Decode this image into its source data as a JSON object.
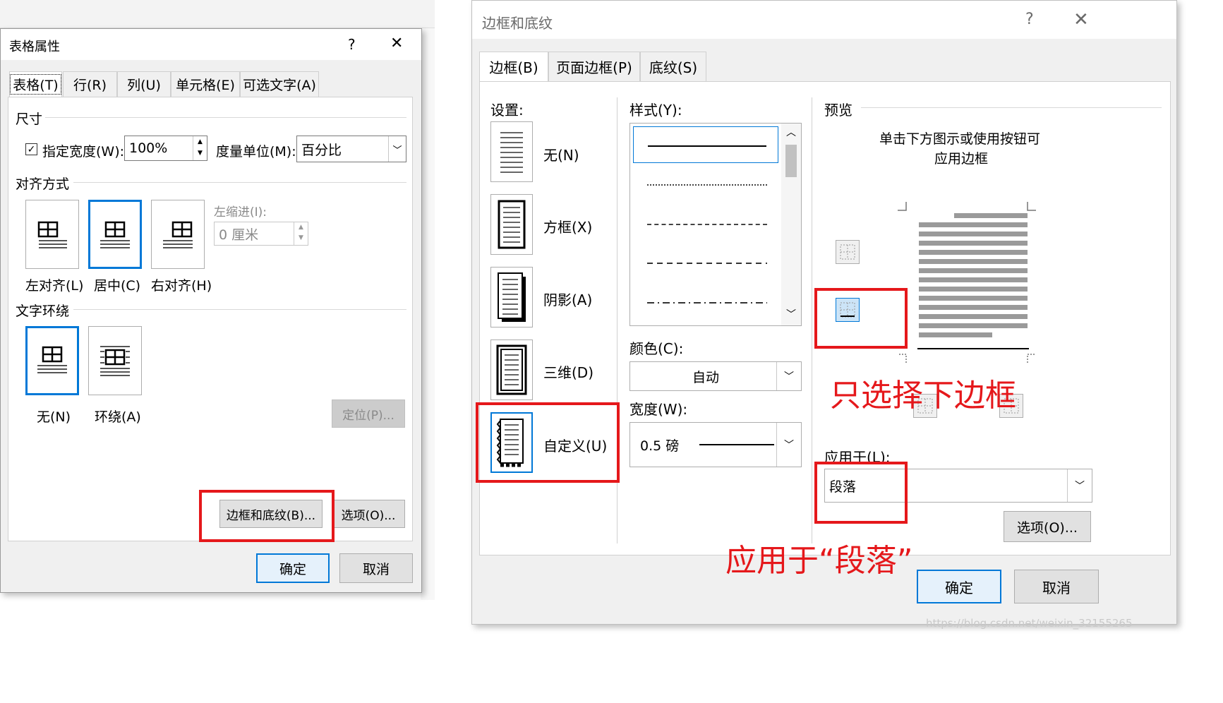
{
  "table_properties": {
    "title": "表格属性",
    "help": "?",
    "close": "✕",
    "tabs": [
      "表格(T)",
      "行(R)",
      "列(U)",
      "单元格(E)",
      "可选文字(A)"
    ],
    "size_group": "尺寸",
    "specify_width_label": "指定宽度(W):",
    "width_value": "100%",
    "unit_label": "度量单位(M):",
    "unit_value": "百分比",
    "alignment_group": "对齐方式",
    "align_left": "左对齐(L)",
    "align_center": "居中(C)",
    "align_right": "右对齐(H)",
    "indent_label": "左缩进(I):",
    "indent_value": "0 厘米",
    "wrap_group": "文字环绕",
    "wrap_none": "无(N)",
    "wrap_around": "环绕(A)",
    "position_button": "定位(P)...",
    "borders_button": "边框和底纹(B)...",
    "options_button": "选项(O)...",
    "ok": "确定",
    "cancel": "取消"
  },
  "borders_shading": {
    "title": "边框和底纹",
    "help": "?",
    "close": "✕",
    "tabs": [
      "边框(B)",
      "页面边框(P)",
      "底纹(S)"
    ],
    "setting_label": "设置:",
    "settings": [
      "无(N)",
      "方框(X)",
      "阴影(A)",
      "三维(D)",
      "自定义(U)"
    ],
    "style_label": "样式(Y):",
    "color_label": "颜色(C):",
    "color_value": "自动",
    "width_label": "宽度(W):",
    "width_value": "0.5 磅",
    "preview_label": "预览",
    "preview_hint_line1": "单击下方图示或使用按钮可",
    "preview_hint_line2": "应用边框",
    "apply_to_label": "应用于(L):",
    "apply_to_value": "段落",
    "options_button": "选项(O)...",
    "ok": "确定",
    "cancel": "取消"
  },
  "annotations": {
    "only_bottom_border": "只选择下边框",
    "apply_to_paragraph": "应用于“段落”"
  },
  "watermark": "https://blog.csdn.net/weixin_32155265",
  "colors": {
    "accent": "#0078d7",
    "annotation_red": "#e5181b",
    "dialog_bg": "#f0f0f0"
  }
}
